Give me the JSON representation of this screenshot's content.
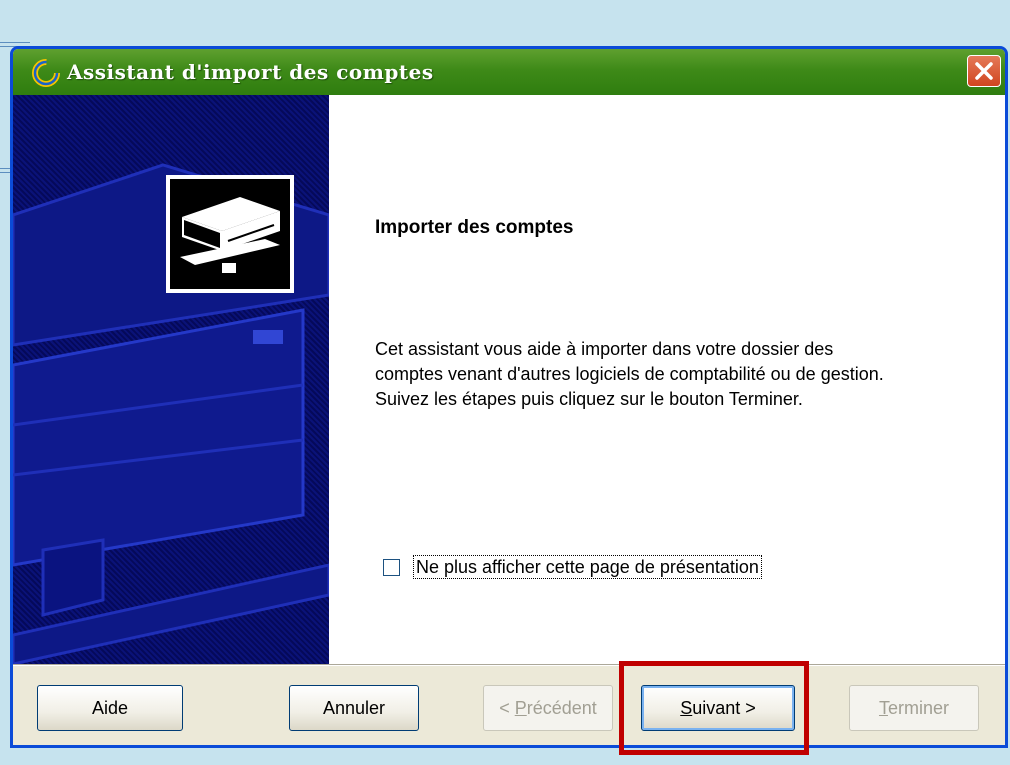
{
  "window": {
    "title": "Assistant d'import des comptes"
  },
  "page": {
    "heading": "Importer des comptes",
    "description": "Cet assistant vous aide à importer dans votre dossier des comptes venant d'autres logiciels de comptabilité ou de gestion. Suivez les étapes puis cliquez sur le bouton Terminer.",
    "checkbox_label": "Ne plus afficher cette page de présentation",
    "checkbox_checked": false
  },
  "buttons": {
    "aide": "Aide",
    "annuler": "Annuler",
    "precedent_prefix": "< ",
    "precedent_mnemonic": "P",
    "precedent_rest": "récédent",
    "suivant_mnemonic": "S",
    "suivant_rest": "uivant >",
    "terminer_mnemonic": "T",
    "terminer_rest": "erminer"
  },
  "colors": {
    "titlebar": "#3e8a18",
    "left_panel": "#0a1278",
    "highlight": "#c00000"
  },
  "icons": {
    "app": "app-c-icon",
    "close": "close-icon",
    "illustration": "hard-drive-icon"
  }
}
